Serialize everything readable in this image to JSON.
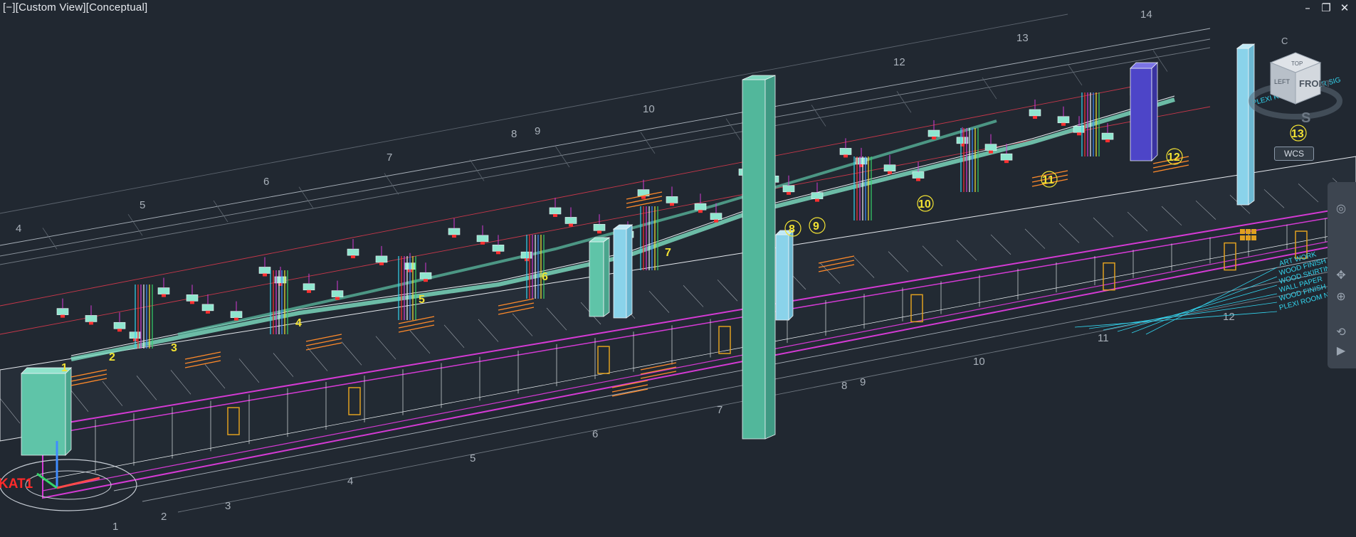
{
  "viewport": {
    "control": "[−]",
    "view": "[Custom View]",
    "style": "[Conceptual]"
  },
  "window_controls": {
    "minimize": "–",
    "restore": "❐",
    "close": "✕"
  },
  "viewcube": {
    "top": "TOP",
    "front": "FRONT",
    "left": "LEFT",
    "south": "S",
    "wcs": "WCS"
  },
  "grid_labels": {
    "top_row": [
      "4",
      "5",
      "6",
      "7",
      "8",
      "9",
      "10",
      "12",
      "13",
      "14"
    ],
    "bottom_row": [
      "1",
      "2",
      "3",
      "4",
      "5",
      "6",
      "7",
      "8",
      "9",
      "10",
      "11"
    ],
    "far_right": "12",
    "far_right_top": "C"
  },
  "room_markers": [
    "1",
    "2",
    "3",
    "4",
    "5",
    "6",
    "7",
    "8",
    "9",
    "10",
    "11",
    "12",
    "13"
  ],
  "legend": {
    "items": [
      "ART WORK",
      "WOOD FINISH SHAFT OF",
      "WOOD SKIRTING",
      "WALL PAPER",
      "WOOD FINISH DOOR",
      "PLEXI ROOM NUMBER SIG"
    ],
    "top_note": "PLEXI ROOM NUMBER SIG"
  },
  "ucs_label": "KAT1",
  "colors": {
    "background": "#212831",
    "teal": "#5fc4a8",
    "magenta": "#d43ad4",
    "cyan": "#33d6f0",
    "orange": "#ff8a2a",
    "yellow": "#f2e233",
    "white": "#eef2f5",
    "purple": "#5a4fd8",
    "red": "#ff2a2a"
  }
}
